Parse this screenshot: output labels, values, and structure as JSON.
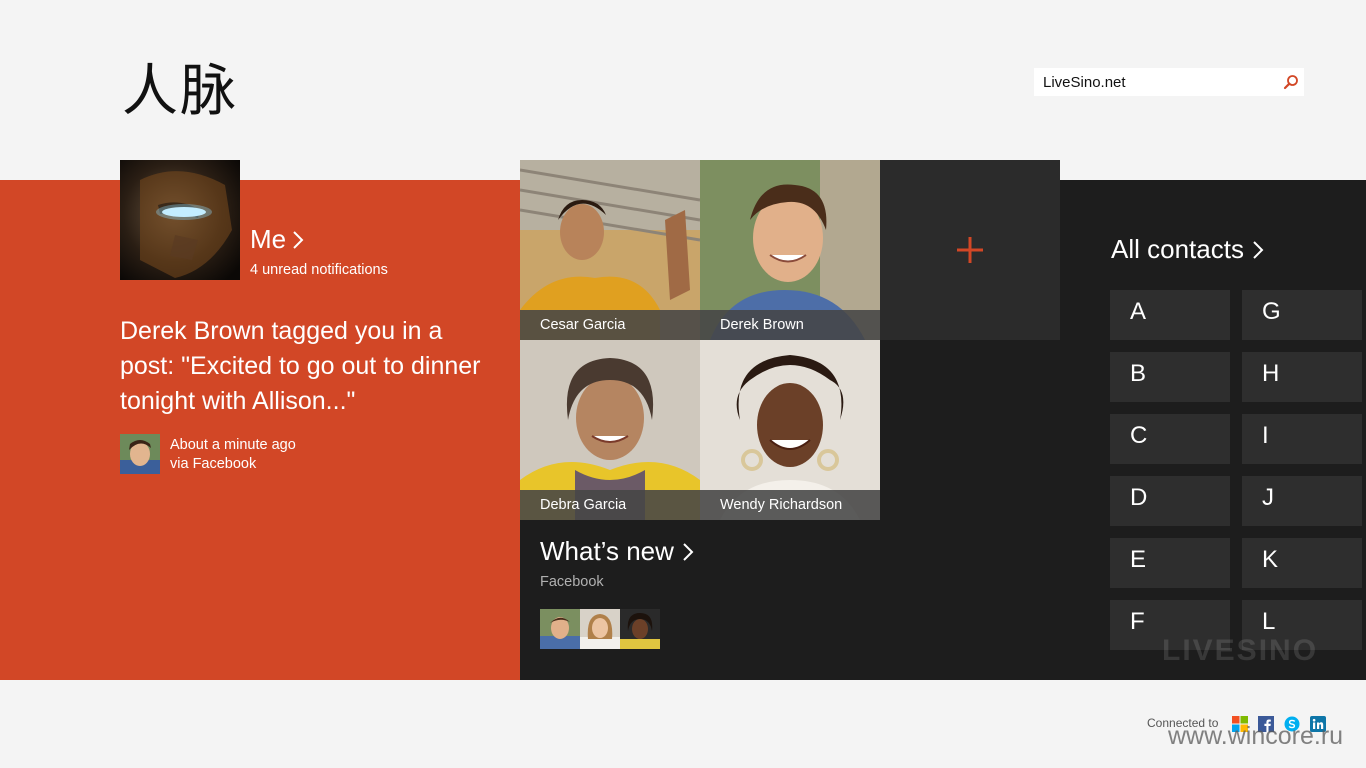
{
  "app": {
    "title": "人脉"
  },
  "search": {
    "value": "LiveSino.net"
  },
  "me": {
    "label": "Me",
    "notifications": "4 unread notifications",
    "avatar_icon": "iron-man-avatar"
  },
  "post": {
    "text": "Derek Brown tagged you in a post: \"Excited to go out to dinner tonight with Allison...\"",
    "time": "About a minute ago",
    "via": "via Facebook"
  },
  "favorites": [
    {
      "name": "Cesar Garcia"
    },
    {
      "name": "Derek Brown"
    },
    {
      "name": "Debra Garcia"
    },
    {
      "name": "Wendy Richardson"
    }
  ],
  "add_tile": {
    "icon": "plus-icon"
  },
  "whats_new": {
    "label": "What’s new",
    "source": "Facebook"
  },
  "all_contacts": {
    "label": "All contacts",
    "letters": [
      "A",
      "B",
      "C",
      "D",
      "E",
      "F",
      "G",
      "H",
      "I",
      "J",
      "K",
      "L"
    ]
  },
  "footer": {
    "connected_to": "Connected to",
    "services": [
      "microsoft-icon",
      "facebook-icon",
      "skype-icon",
      "linkedin-icon"
    ]
  },
  "watermarks": {
    "logo": "LIVESINO",
    "site": "www.wincore.ru"
  },
  "colors": {
    "accent": "#d24726",
    "dark": "#1d1d1d",
    "tile": "#2e2e2e",
    "background": "#f4f4f4"
  }
}
